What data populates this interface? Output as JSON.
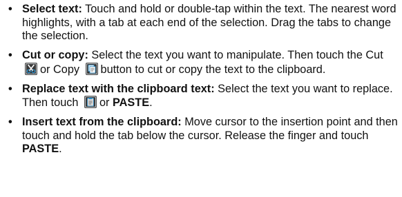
{
  "items": [
    {
      "bullet": "•",
      "term": "Select text:",
      "text": " Touch and hold or double-tap within the text. The nearest word highlights, with a tab at each end of the selection. Drag the tabs to change the selection."
    },
    {
      "bullet": "•",
      "term": "Cut or copy:",
      "text_before_cut_icon": " Select the text you want to manipulate. Then touch the Cut",
      "text_between_icons": "or Copy",
      "text_after_copy_icon": "button to cut or copy the text to the clipboard.",
      "cut_icon": "cut-icon",
      "copy_icon": "copy-icon"
    },
    {
      "bullet": "•",
      "term": "Replace text with the clipboard text:",
      "text_before_icon": " Select the text you want to replace. Then touch",
      "icon": "paste-icon",
      "text_between": "or",
      "paste_label": "PASTE",
      "text_end": "."
    },
    {
      "bullet": "•",
      "term": "Insert text from the clipboard:",
      "text_before_paste": " Move cursor to the insertion point and then touch and hold the tab below the cursor. Release the finger and touch",
      "paste_label": "PASTE",
      "text_end": "."
    }
  ],
  "colors": {
    "text": "#111111",
    "icon_dark": "#3a3a3a",
    "icon_light": "#bfc2c4",
    "icon_blue": "#2e8ec9"
  }
}
